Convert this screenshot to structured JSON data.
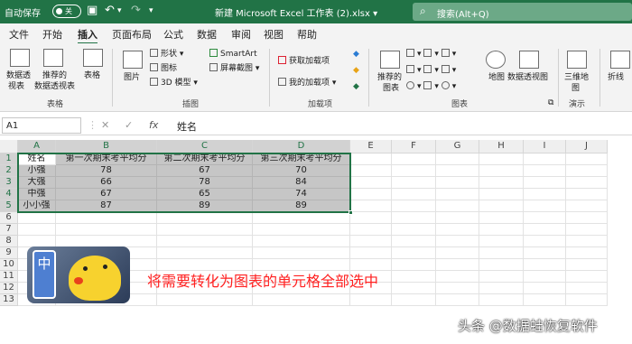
{
  "titlebar": {
    "autosave_label": "自动保存",
    "autosave_state": "关",
    "title": "新建 Microsoft Excel 工作表 (2).xlsx",
    "title_dropdown": "▾",
    "search_placeholder": "搜索(Alt+Q)",
    "save_icon": "▣",
    "undo_icon": "↶",
    "undo_drop": "▾",
    "redo_icon": "↷",
    "more_icon": "▾"
  },
  "menu": [
    "文件",
    "开始",
    "插入",
    "页面布局",
    "公式",
    "数据",
    "审阅",
    "视图",
    "帮助"
  ],
  "menu_active": "插入",
  "ribbon": {
    "pivot_label_1": "数据透",
    "pivot_label_2": "视表",
    "rec_pivot_1": "推荐的",
    "rec_pivot_2": "数据透视表",
    "table_label": "表格",
    "group_tables": "表格",
    "pictures_label": "图片",
    "shapes_label": "形状",
    "icons_label": "图标",
    "model3d_label": "3D 模型",
    "smartart_label": "SmartArt",
    "screenshot_label": "屏幕截图",
    "group_illustrations": "插图",
    "get_addins": "获取加载项",
    "my_addins": "我的加载项",
    "group_addins": "加载项",
    "rec_charts_1": "推荐的",
    "rec_charts_2": "图表",
    "group_charts": "图表",
    "maps_label": "地图",
    "pivotchart_label": "数据透视图",
    "map3d_1": "三维地",
    "map3d_2": "图",
    "group_tours": "演示",
    "sparkline_label": "折线"
  },
  "formula_bar": {
    "name_box": "A1",
    "cancel": "✕",
    "enter": "✓",
    "fx": "fx",
    "content": "姓名"
  },
  "columns": [
    "A",
    "B",
    "C",
    "D",
    "E",
    "F",
    "G",
    "H",
    "I",
    "J"
  ],
  "rows": [
    "1",
    "2",
    "3",
    "4",
    "5",
    "6",
    "7",
    "8",
    "9",
    "10",
    "11",
    "12",
    "13"
  ],
  "table": {
    "header": [
      "姓名",
      "第一次期末考平均分",
      "第二次期末考平均分",
      "第三次期末考平均分"
    ],
    "body": [
      [
        "小强",
        "78",
        "67",
        "70"
      ],
      [
        "大强",
        "66",
        "78",
        "84"
      ],
      [
        "中强",
        "67",
        "65",
        "74"
      ],
      [
        "小小强",
        "87",
        "89",
        "89"
      ]
    ]
  },
  "overlay": {
    "caption": "将需要转化为图表的单元格全部选中",
    "watermark": "头条 @数据蛙恢复软件",
    "cartoon_char": "中"
  }
}
